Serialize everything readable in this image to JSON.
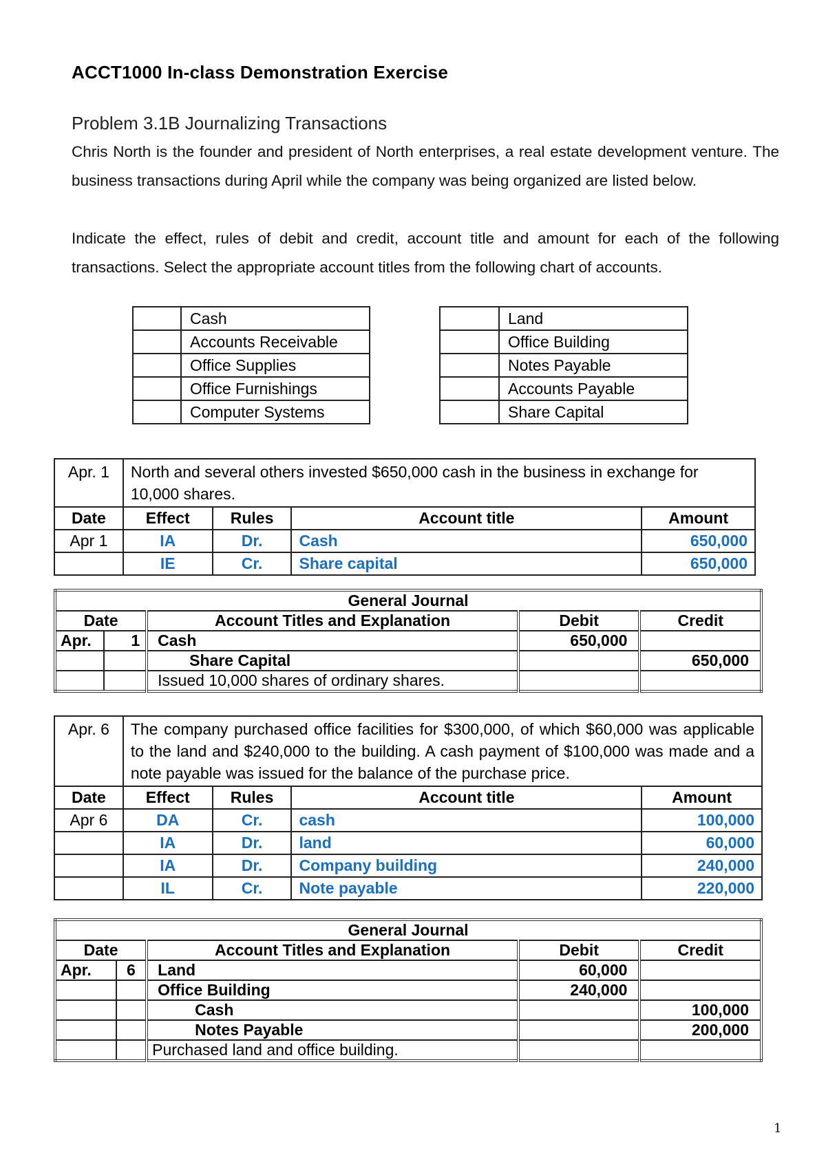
{
  "header": {
    "title": "ACCT1000 In-class Demonstration Exercise",
    "problem_heading": "Problem 3.1B Journalizing Transactions",
    "intro": "Chris North is the founder and president of North enterprises, a real estate development venture. The business transactions during April while the company was being organized are listed below.",
    "instructions": "Indicate the effect, rules of debit and credit, account title and amount for each of the following transactions.  Select the appropriate account titles from the following chart of accounts."
  },
  "chart_of_accounts": {
    "left": [
      "Cash",
      "Accounts Receivable",
      "Office Supplies",
      "Office Furnishings",
      "Computer Systems"
    ],
    "right": [
      "Land",
      "Office Building",
      "Notes Payable",
      "Accounts Payable",
      "Share Capital"
    ]
  },
  "analysis_headers": {
    "date": "Date",
    "effect": "Effect",
    "rules": "Rules",
    "account_title": "Account title",
    "amount": "Amount"
  },
  "journal_headers": {
    "title": "General Journal",
    "date": "Date",
    "account_titles": "Account Titles and Explanation",
    "debit": "Debit",
    "credit": "Credit"
  },
  "transactions": [
    {
      "date_label": "Apr.  1",
      "description": "North and several others invested $650,000 cash in the business in exchange for 10,000 shares.",
      "rows": [
        {
          "date": "Apr  1",
          "effect": "IA",
          "rule": "Dr.",
          "account": "Cash",
          "amount": "650,000"
        },
        {
          "date": "",
          "effect": "IE",
          "rule": "Cr.",
          "account": "Share capital",
          "amount": "650,000"
        }
      ],
      "journal": {
        "month": "Apr.",
        "day": "1",
        "entries": [
          {
            "account": "Cash",
            "debit": "650,000",
            "credit": ""
          },
          {
            "account": "Share Capital",
            "debit": "",
            "credit": "650,000"
          }
        ],
        "explanation": "Issued 10,000 shares of ordinary shares."
      }
    },
    {
      "date_label": "Apr.  6",
      "description": "The company purchased office facilities for $300,000, of which $60,000 was applicable to the land and $240,000 to the building. A cash payment of $100,000 was made and a note payable was issued for the balance of the purchase price.",
      "rows": [
        {
          "date": "Apr  6",
          "effect": "DA",
          "rule": "Cr.",
          "account": "cash",
          "amount": "100,000"
        },
        {
          "date": "",
          "effect": "IA",
          "rule": "Dr.",
          "account": "land",
          "amount": "60,000"
        },
        {
          "date": "",
          "effect": "IA",
          "rule": "Dr.",
          "account": "Company building",
          "amount": "240,000"
        },
        {
          "date": "",
          "effect": "IL",
          "rule": "Cr.",
          "account": "Note payable",
          "amount": "220,000"
        }
      ],
      "journal": {
        "month": "Apr.",
        "day": "6",
        "entries": [
          {
            "account": "Land",
            "debit": "60,000",
            "credit": ""
          },
          {
            "account": "Office Building",
            "debit": "240,000",
            "credit": ""
          },
          {
            "account": "Cash",
            "debit": "",
            "credit": "100,000"
          },
          {
            "account": "Notes Payable",
            "debit": "",
            "credit": "200,000"
          }
        ],
        "explanation": "Purchased land and office building."
      }
    }
  ],
  "colors": {
    "answer_blue": "#1a6fc0"
  },
  "footer": {
    "page_number": "1"
  }
}
